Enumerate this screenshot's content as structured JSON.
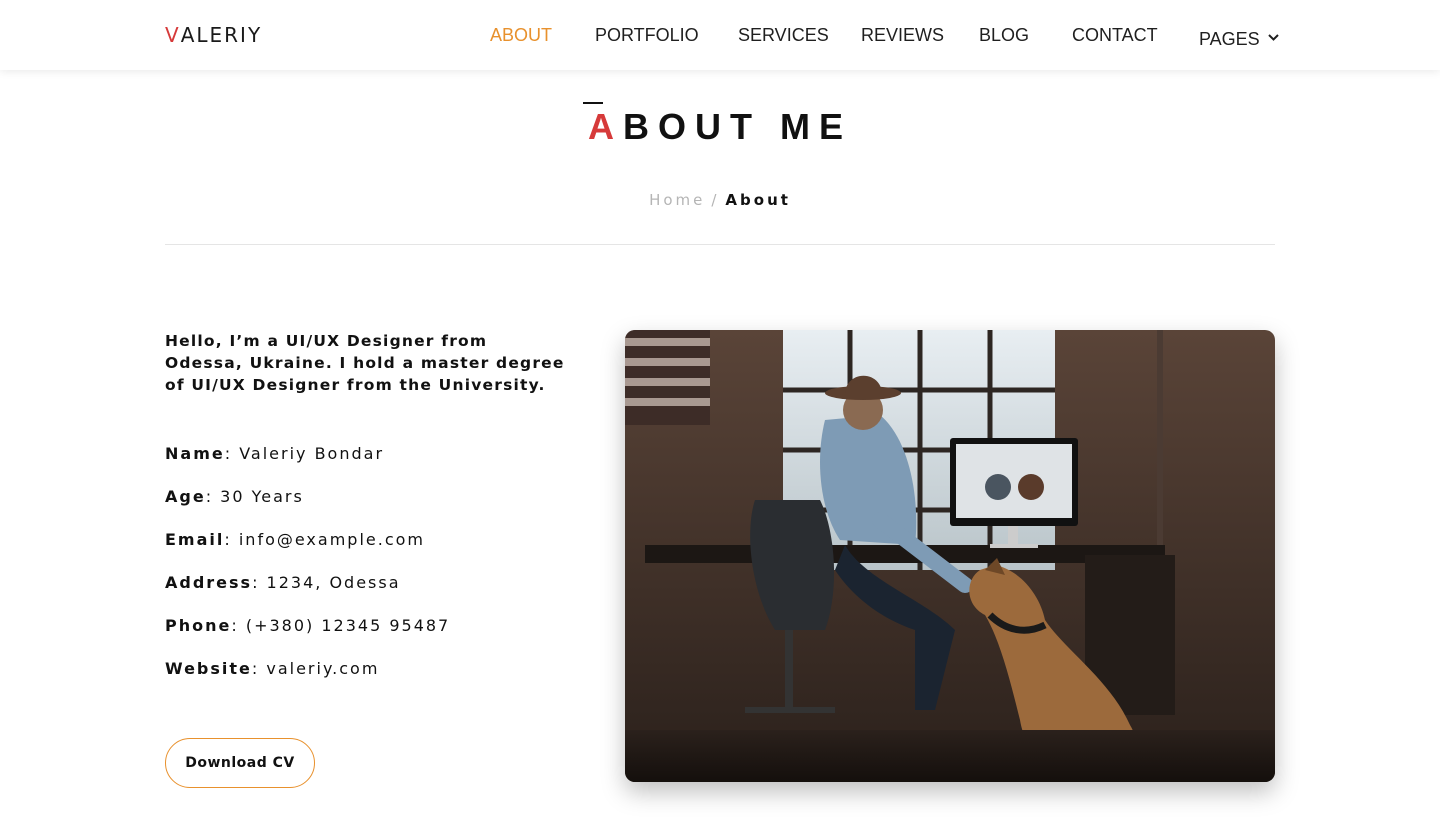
{
  "brand": {
    "logo_first": "V",
    "logo_rest": "ALERIY",
    "accent": "#e8912d",
    "red": "#d63a3a"
  },
  "nav": {
    "items": [
      {
        "label": "ABOUT",
        "active": true
      },
      {
        "label": "PORTFOLIO"
      },
      {
        "label": "SERVICES"
      },
      {
        "label": "REVIEWS"
      },
      {
        "label": "BLOG"
      },
      {
        "label": "CONTACT"
      },
      {
        "label": "PAGES",
        "icon": "chevron-down-icon"
      }
    ]
  },
  "page": {
    "title_first": "A",
    "title_rest": "BOUT ME",
    "breadcrumb": {
      "home": "Home",
      "separator": "/",
      "current": "About"
    }
  },
  "about": {
    "intro": "Hello, I’m a UI/UX Designer from Odessa, Ukraine. I hold a master degree of UI/UX Designer from the University.",
    "info": [
      {
        "key": "Name",
        "value": ": Valeriy Bondar"
      },
      {
        "key": "Age",
        "value": ": 30 Years"
      },
      {
        "key": "Email",
        "value": ": info@example.com"
      },
      {
        "key": "Address",
        "value": ": 1234, Odessa"
      },
      {
        "key": "Phone",
        "value": ": (+380) 12345 95487"
      },
      {
        "key": "Website",
        "value": ": valeriy.com"
      }
    ],
    "cv_button": "Download CV",
    "photo_alt_icon": "photo-man-with-dog-at-desk"
  }
}
